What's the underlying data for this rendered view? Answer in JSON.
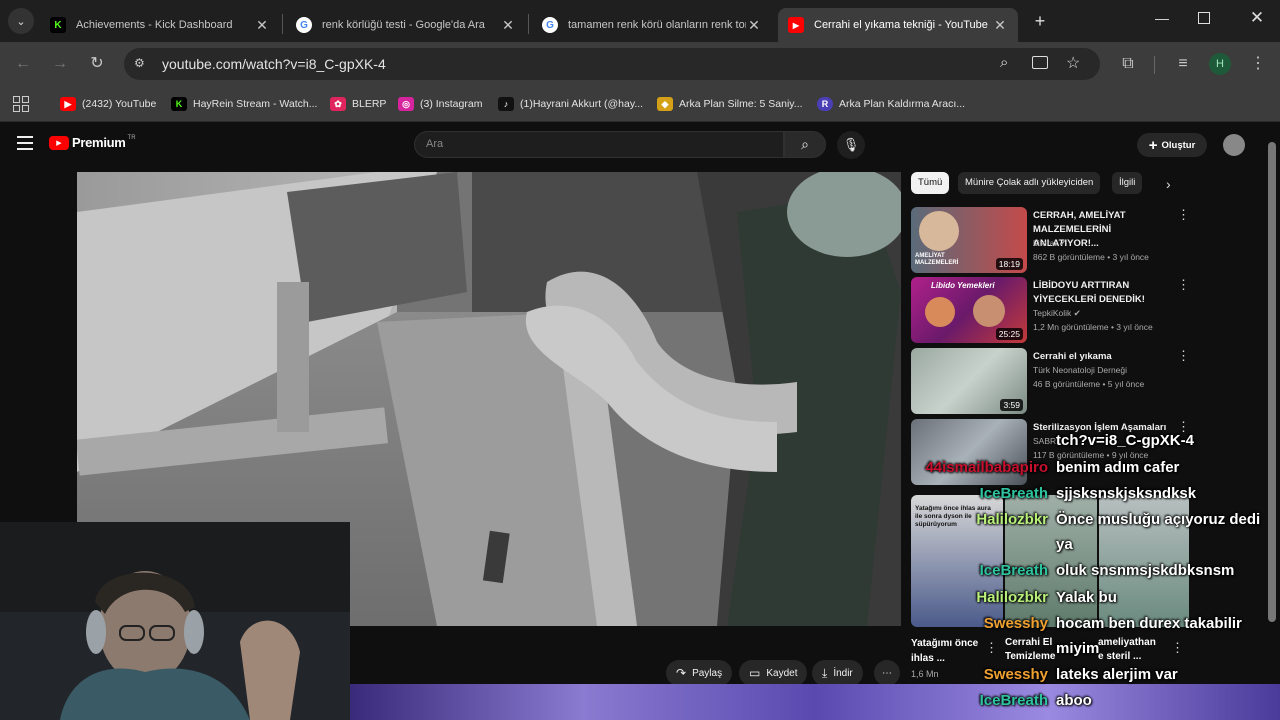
{
  "browser": {
    "tabs": [
      {
        "title": "Achievements - Kick Dashboard",
        "favicon": "K",
        "favcolor": "#53fc18",
        "active": false
      },
      {
        "title": "renk körlüğü testi - Google'da Ara",
        "favicon": "G",
        "favcolor": "#ffffff",
        "active": false
      },
      {
        "title": "tamamen renk körü olanların renk tonları",
        "favicon": "G",
        "favcolor": "#ffffff",
        "active": false
      },
      {
        "title": "Cerrahi el yıkama tekniği - YouTube",
        "favicon": "▶",
        "favcolor": "#ff0000",
        "active": true
      }
    ],
    "new_tab": "+",
    "url": "youtube.com/watch?v=i8_C-gpXK-4",
    "profile_initial": "H",
    "bookmarks": [
      {
        "label": "(2432) YouTube",
        "icon": "▶",
        "color": "#ff0000"
      },
      {
        "label": "HayRein Stream - Watch...",
        "icon": "K",
        "color": "#53fc18"
      },
      {
        "label": "BLERP",
        "icon": "✿",
        "color": "#e0245e"
      },
      {
        "label": "(3) Instagram",
        "icon": "◎",
        "color": "#d6249f"
      },
      {
        "label": "(1)Hayrani Akkurt (@hay...",
        "icon": "♪",
        "color": "#111111"
      },
      {
        "label": "Arka Plan Silme: 5 Saniy...",
        "icon": "◆",
        "color": "#d4a017"
      },
      {
        "label": "Arka Plan Kaldırma Aracı...",
        "icon": "R",
        "color": "#4b3fb5"
      }
    ]
  },
  "youtube": {
    "logo_text": "Premium",
    "logo_region": "TR",
    "search_placeholder": "Ara",
    "create_label": "Oluştur",
    "chips": [
      "Tümü",
      "Münire Çolak adlı yükleyiciden",
      "İlgili"
    ],
    "recommendations": [
      {
        "title": "CERRAH, AMELİYAT MALZEMELERİNİ ANLATIYOR!...",
        "channel": "Literat",
        "verified": true,
        "meta": "862 B görüntüleme • 3 yıl önce",
        "duration": "18:19",
        "thumb_text": "AMELİYAT MALZEMELERİ"
      },
      {
        "title": "LİBİDOYU ARTTIRAN YİYECEKLERİ DENEDİK!",
        "channel": "TepkiKolik",
        "verified": true,
        "meta": "1,2 Mn görüntüleme • 3 yıl önce",
        "duration": "25:25",
        "thumb_text": "Libido Yemekleri"
      },
      {
        "title": "Cerrahi el yıkama",
        "channel": "Türk Neonatoloji Derneği",
        "verified": false,
        "meta": "46 B görüntüleme • 5 yıl önce",
        "duration": "3:59",
        "thumb_text": ""
      },
      {
        "title": "Sterilizasyon İşlem Aşamaları",
        "channel": "SABRI...",
        "verified": false,
        "meta": "117 B görüntüleme • 9 yıl önce",
        "duration": "",
        "thumb_text": ""
      }
    ],
    "shorts": [
      {
        "title": "Yatağımı önce ihlas ...",
        "meta": "1,6 Mn",
        "thumb_text": "Yatağımı önce ihlas aura ile sonra dyson ile süpürüyorum"
      },
      {
        "title": "Cerrahi El Temizleme ...",
        "meta": "",
        "thumb_text": ""
      },
      {
        "title": "ameliyathan e steril ...",
        "meta": "",
        "thumb_text": ""
      }
    ],
    "actions": {
      "share": "Paylaş",
      "save": "Kaydet",
      "download": "İndir"
    }
  },
  "chat": {
    "messages": [
      {
        "user": "",
        "text": "tch?v=i8_C-gpXK-4",
        "color": "#ffffff"
      },
      {
        "user": "44ismailbabapiro",
        "text": "benim adım cafer",
        "color": "#c8102e"
      },
      {
        "user": "IceBreath",
        "text": "sjjsksnskjsksndksk",
        "color": "#2ec4a0"
      },
      {
        "user": "Halilozbkr",
        "text": "Önce musluğu açıyoruz dedi",
        "color": "#b8f07a"
      },
      {
        "user": "",
        "text": "ya",
        "color": "#ffffff"
      },
      {
        "user": "IceBreath",
        "text": "oluk snsnmsjskdbksnsm",
        "color": "#2ec4a0"
      },
      {
        "user": "Halilozbkr",
        "text": "Yalak bu",
        "color": "#b8f07a"
      },
      {
        "user": "Swesshy",
        "text": "hocam ben durex takabilir",
        "color": "#f0a030"
      },
      {
        "user": "",
        "text": "miyim",
        "color": "#ffffff"
      },
      {
        "user": "Swesshy",
        "text": "lateks alerjim var",
        "color": "#f0a030"
      },
      {
        "user": "IceBreath",
        "text": "aboo",
        "color": "#2ec4a0"
      }
    ]
  }
}
